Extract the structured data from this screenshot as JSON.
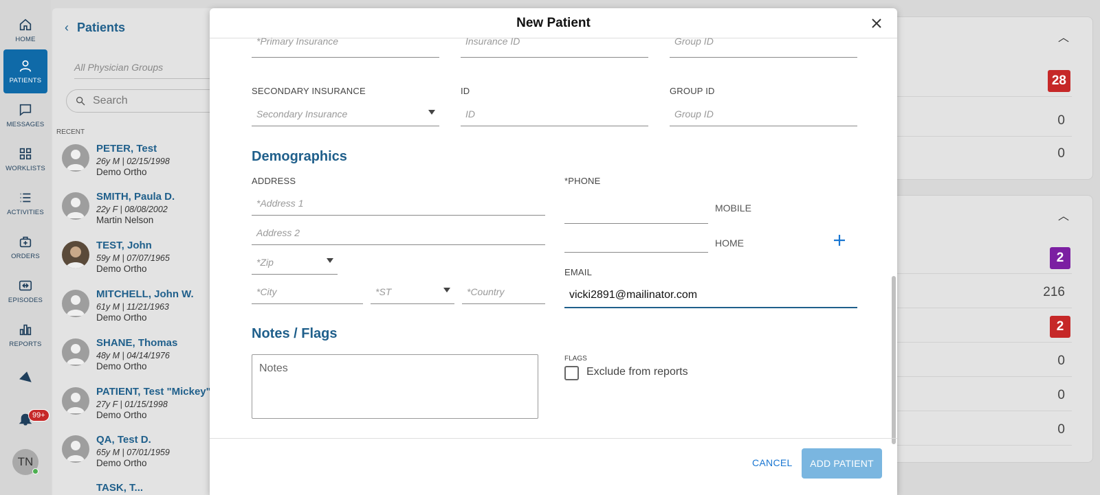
{
  "nav": {
    "items": [
      {
        "label": "HOME",
        "icon": "home-icon"
      },
      {
        "label": "PATIENTS",
        "icon": "person-icon"
      },
      {
        "label": "MESSAGES",
        "icon": "chat-icon"
      },
      {
        "label": "WORKLISTS",
        "icon": "grid-icon"
      },
      {
        "label": "ACTIVITIES",
        "icon": "list-icon"
      },
      {
        "label": "ORDERS",
        "icon": "medical-bag-icon"
      },
      {
        "label": "EPISODES",
        "icon": "episodes-icon"
      },
      {
        "label": "REPORTS",
        "icon": "bar-chart-icon"
      }
    ],
    "notification_badge": "99+",
    "user_initials": "TN"
  },
  "patients_panel": {
    "title": "Patients",
    "physician_groups_placeholder": "All Physician Groups",
    "search_placeholder": "Search",
    "recent_label": "RECENT",
    "patients": [
      {
        "name": "PETER, Test",
        "info": "26y M | 02/15/1998",
        "group": "Demo Ortho"
      },
      {
        "name": "SMITH, Paula D.",
        "info": "22y F | 08/08/2002",
        "group": "Martin Nelson"
      },
      {
        "name": "TEST, John",
        "info": "59y M | 07/07/1965",
        "group": "Demo Ortho"
      },
      {
        "name": "MITCHELL, John W.",
        "info": "61y M | 11/21/1963",
        "group": "Demo Ortho"
      },
      {
        "name": "SHANE, Thomas",
        "info": "48y M | 04/14/1976",
        "group": "Demo Ortho"
      },
      {
        "name": "PATIENT, Test \"Mickey\"",
        "info": "27y F | 01/15/1998",
        "group": "Demo Ortho"
      },
      {
        "name": "QA, Test D.",
        "info": "65y M | 07/01/1959",
        "group": "Demo Ortho"
      },
      {
        "name": "TASK, T...",
        "info": "",
        "group": ""
      }
    ]
  },
  "right_panel": {
    "top_values": [
      "28",
      "0",
      "0"
    ],
    "bottom_values": [
      "2",
      "216",
      "2",
      "0",
      "0",
      "0"
    ]
  },
  "modal": {
    "title": "New Patient",
    "primary_insurance_placeholder": "*Primary Insurance",
    "primary_insurance_id_placeholder": "Insurance ID",
    "primary_group_id_placeholder": "Group ID",
    "secondary_insurance_label": "SECONDARY INSURANCE",
    "secondary_insurance_placeholder": "Secondary Insurance",
    "id_label": "ID",
    "id_placeholder": "ID",
    "group_id_label": "GROUP ID",
    "group_id_placeholder": "Group ID",
    "demographics_title": "Demographics",
    "address_label": "ADDRESS",
    "address1_placeholder": "*Address 1",
    "address2_placeholder": "Address 2",
    "zip_placeholder": "*Zip",
    "city_placeholder": "*City",
    "state_placeholder": "*ST",
    "country_placeholder": "*Country",
    "phone_label": "*PHONE",
    "phone_type_mobile": "MOBILE",
    "phone_type_home": "HOME",
    "email_label": "EMAIL",
    "email_value": "vicki2891@mailinator.com",
    "notes_title": "Notes / Flags",
    "notes_placeholder": "Notes",
    "flags_label": "FLAGS",
    "exclude_label": "Exclude from reports",
    "cancel_label": "CANCEL",
    "add_label": "ADD PATIENT"
  },
  "colors": {
    "brand": "#1f5f8b",
    "nav_active": "#0f6aa8",
    "badge_red": "#c62828",
    "badge_purple": "#7b1fa2",
    "add_button": "#7ab6e0"
  }
}
